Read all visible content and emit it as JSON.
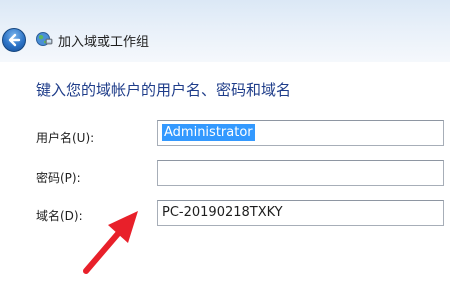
{
  "window": {
    "title": "加入域或工作组"
  },
  "form": {
    "instruction": "键入您的域帐户的用户名、密码和域名",
    "username": {
      "label": "用户名(U):",
      "value": "Administrator"
    },
    "password": {
      "label": "密码(P):",
      "value": ""
    },
    "domain": {
      "label": "域名(D):",
      "value": "PC-20190218TXKY"
    }
  },
  "colors": {
    "instruction_text": "#1f3d8a",
    "selection": "#3399ff",
    "annotation_arrow": "#e8202a",
    "back_button": "#2c73c6"
  },
  "icons": {
    "back": "back-arrow-icon",
    "window": "network-globe-icon"
  }
}
